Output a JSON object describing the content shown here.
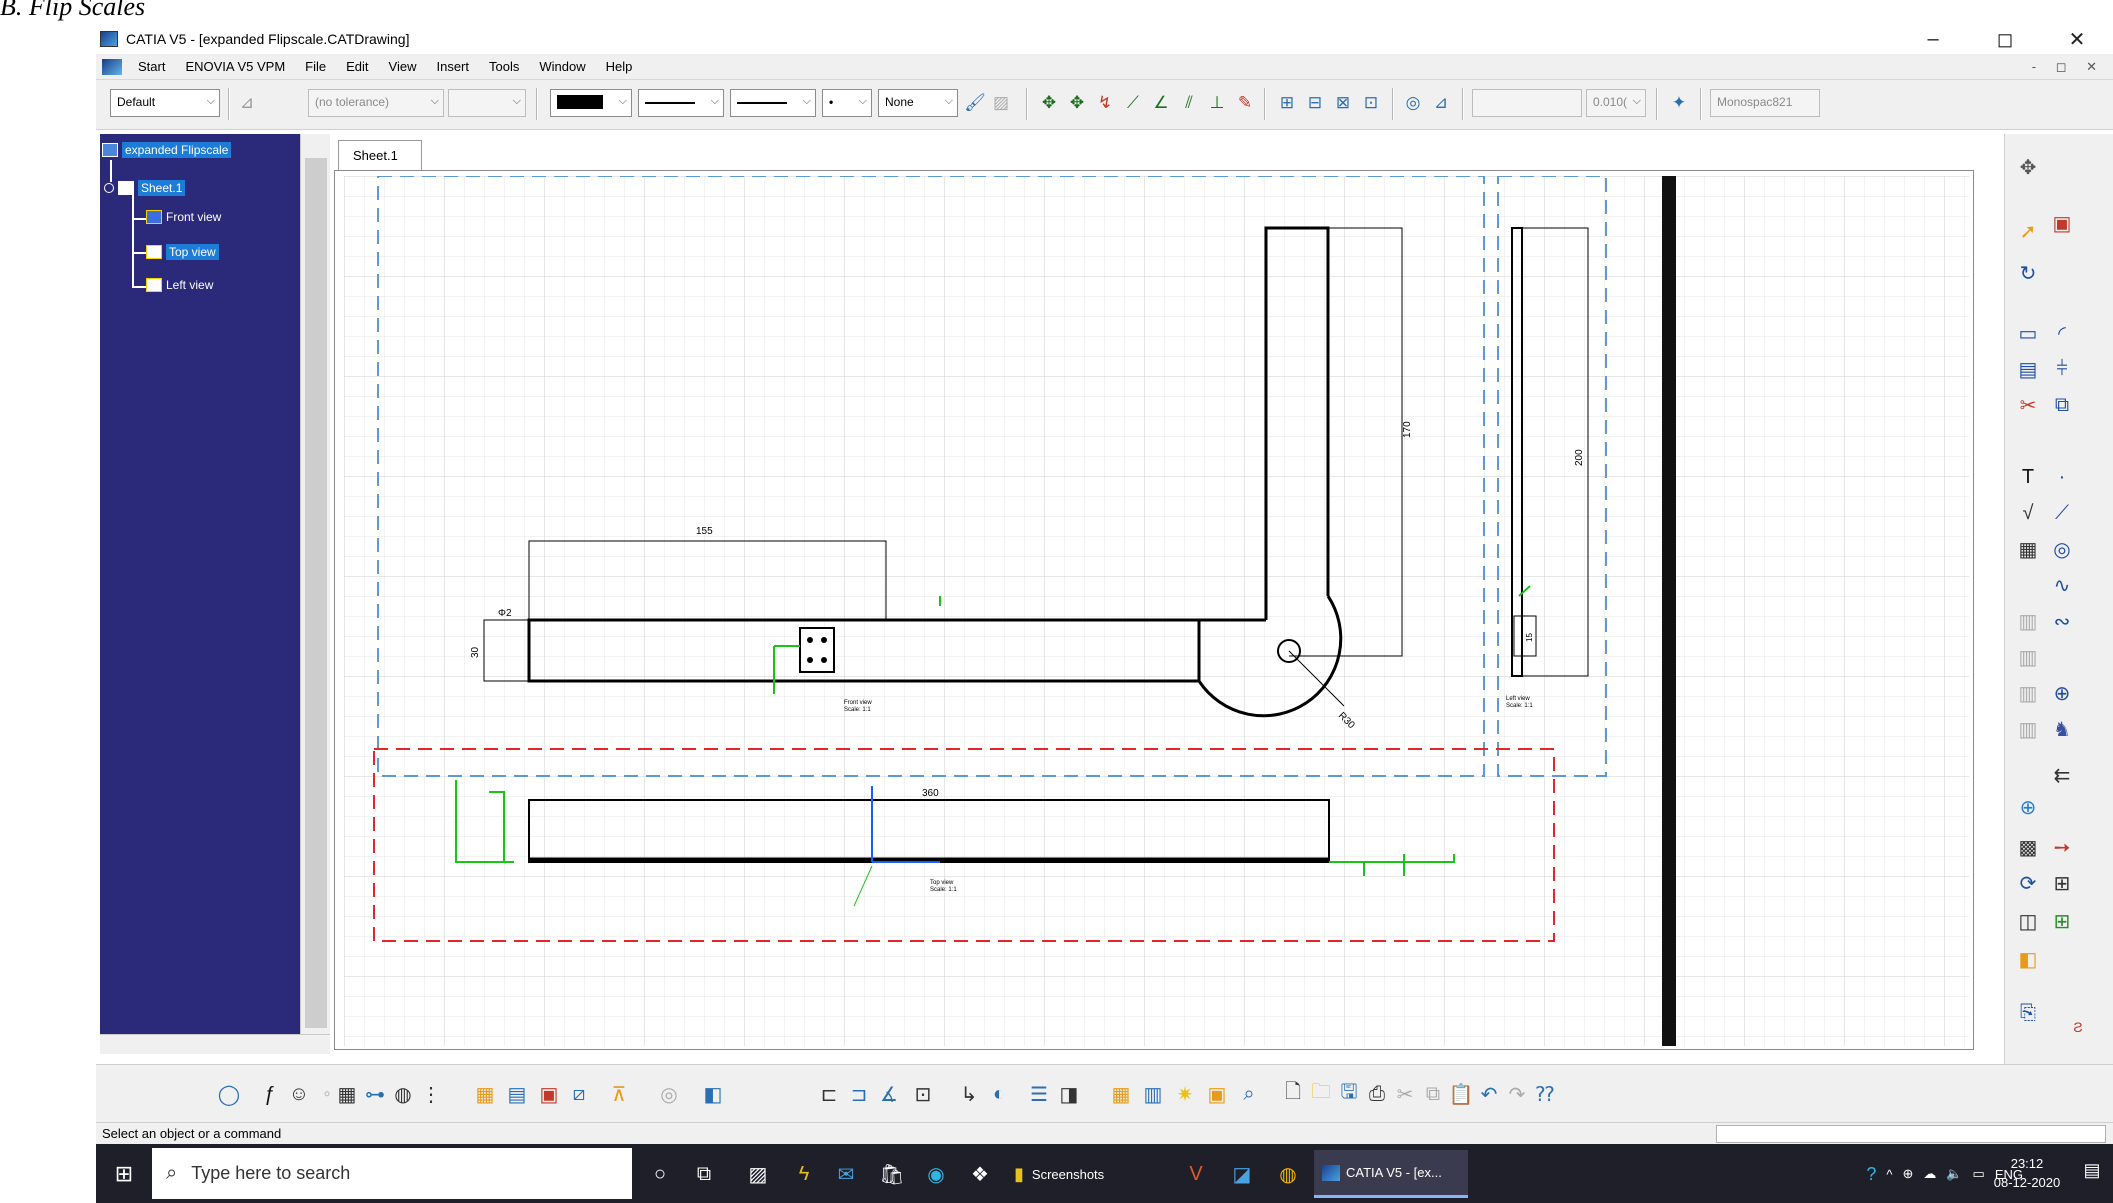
{
  "caption": "B.   Flip Scales",
  "window": {
    "title": "CATIA V5 - [expanded Flipscale.CATDrawing]",
    "minimize": "–",
    "maximize": "◻",
    "close": "✕"
  },
  "menu": [
    "Start",
    "ENOVIA V5 VPM",
    "File",
    "Edit",
    "View",
    "Insert",
    "Tools",
    "Window",
    "Help"
  ],
  "menu_doc_controls": "- ◻ ✕",
  "format_toolbar": {
    "style_combo": "Default",
    "tolerance_combo": "(no tolerance)",
    "pattern_combo": "None",
    "value_combo": "0.010(",
    "font_combo": "Monospac821"
  },
  "tree": {
    "root": "expanded Flipscale",
    "sheet": "Sheet.1",
    "views": [
      "Front view",
      "Top view",
      "Left view"
    ]
  },
  "sheet_tab": "Sheet.1",
  "drawing": {
    "dims": {
      "top_width": "155",
      "vertical_arm": "170",
      "left_view_height": "200",
      "bottom_length": "360",
      "bar_height": "30",
      "hole_dia": "Φ2",
      "radius": "R30",
      "left_view_small": "15"
    },
    "view_labels": {
      "front": "Front view",
      "top": "Top view",
      "left": "Left view",
      "scale": "Scale: 1:1"
    }
  },
  "status": {
    "text": "Select an object or a command"
  },
  "taskbar": {
    "search_placeholder": "Type here to search",
    "screenshots_label": "Screenshots",
    "catia_label": "CATIA V5 - [ex...",
    "lang": "ENG",
    "time": "23:12",
    "date": "08-12-2020"
  },
  "colors": {
    "tree_bg": "#2b2a7a",
    "grid": "#d8d8d8",
    "front_frame": "#5b9bd5",
    "top_frame": "#e0282a",
    "dim_green": "#19c419",
    "axis_blue": "#1a5cff"
  }
}
